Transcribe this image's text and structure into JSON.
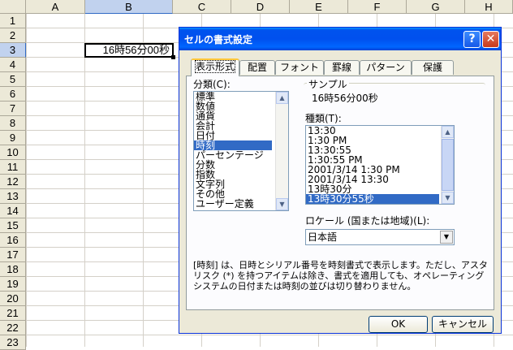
{
  "sheet": {
    "columns": [
      "A",
      "B",
      "C",
      "D",
      "E",
      "F",
      "G",
      "H"
    ],
    "rows": [
      "1",
      "2",
      "3",
      "4",
      "5",
      "6",
      "7",
      "8",
      "9",
      "10",
      "11",
      "12",
      "13",
      "14",
      "15",
      "16",
      "17",
      "18",
      "19",
      "20",
      "21",
      "22",
      "23"
    ],
    "selected_column": "B",
    "selected_row": "3",
    "active_cell_value": "16時56分00秒"
  },
  "dialog": {
    "title": "セルの書式設定",
    "tabs": [
      "表示形式",
      "配置",
      "フォント",
      "罫線",
      "パターン",
      "保護"
    ],
    "category_label": "分類(C):",
    "categories": [
      "標準",
      "数値",
      "通貨",
      "会計",
      "日付",
      "時刻",
      "パーセンテージ",
      "分数",
      "指数",
      "文字列",
      "その他",
      "ユーザー定義"
    ],
    "selected_category": "時刻",
    "sample_label": "サンプル",
    "sample_value": "16時56分00秒",
    "type_label": "種類(T):",
    "types": [
      "13:30",
      "1:30 PM",
      "13:30:55",
      "1:30:55 PM",
      "2001/3/14 1:30 PM",
      "2001/3/14 13:30",
      "13時30分",
      "13時30分55秒"
    ],
    "selected_type": "13時30分55秒",
    "locale_label": "ロケール (国または地域)(L):",
    "locale_value": "日本語",
    "description": "[時刻] は、日時とシリアル番号を時刻書式で表示します。ただし、アスタリスク (*) を持つアイテムは除き、書式を適用しても、オペレーティング システムの日付または時刻の並びは切り替わりません。",
    "ok_label": "OK",
    "cancel_label": "キャンセル",
    "help_label": "?",
    "close_label": "✕"
  }
}
